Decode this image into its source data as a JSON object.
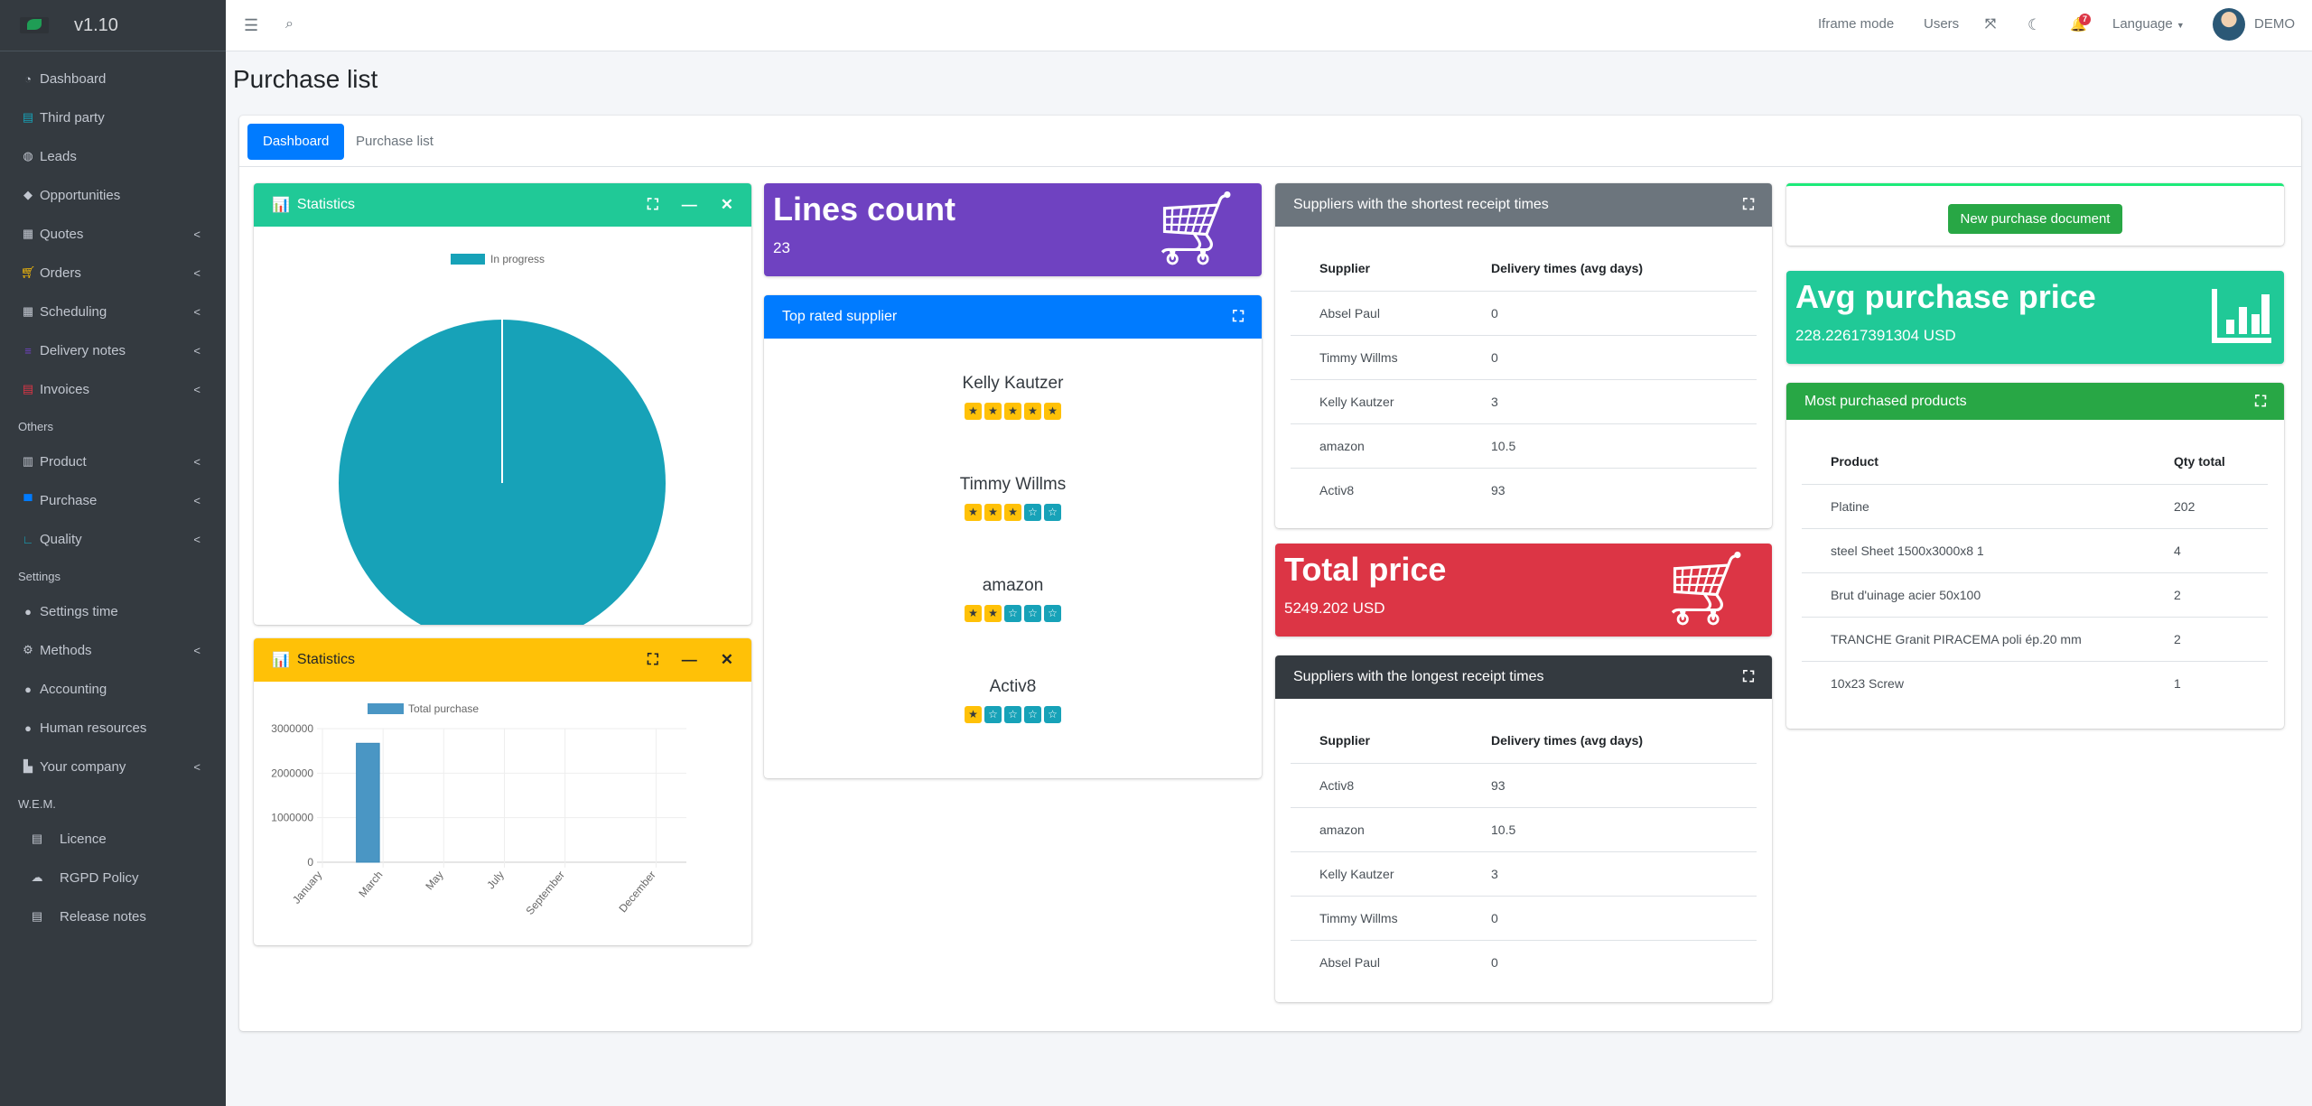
{
  "app": {
    "version": "v1.10"
  },
  "sidebar": {
    "items": [
      {
        "label": "Dashboard",
        "icon": "tachometer-icon"
      },
      {
        "label": "Third party",
        "icon": "address-book-icon"
      },
      {
        "label": "Leads",
        "icon": "globe-icon"
      },
      {
        "label": "Opportunities",
        "icon": "tags-icon"
      },
      {
        "label": "Quotes",
        "icon": "calculator-icon",
        "chevron": true
      },
      {
        "label": "Orders",
        "icon": "cart-icon",
        "chevron": true
      },
      {
        "label": "Scheduling",
        "icon": "calendar-icon",
        "chevron": true
      },
      {
        "label": "Delivery notes",
        "icon": "list-icon",
        "chevron": true
      },
      {
        "label": "Invoices",
        "icon": "invoice-icon",
        "chevron": true
      }
    ],
    "others_header": "Others",
    "others": [
      {
        "label": "Product",
        "icon": "barcode-icon",
        "chevron": true
      },
      {
        "label": "Purchase",
        "icon": "shopping-bag-icon",
        "chevron": true
      },
      {
        "label": "Quality",
        "icon": "ruler-icon",
        "chevron": true
      }
    ],
    "settings_header": "Settings",
    "settings": [
      {
        "label": "Settings time",
        "icon": "user-clock-icon"
      },
      {
        "label": "Methods",
        "icon": "cogs-icon",
        "chevron": true
      },
      {
        "label": "Accounting",
        "icon": "piggy-bank-icon"
      },
      {
        "label": "Human resources",
        "icon": "users-icon"
      },
      {
        "label": "Your company",
        "icon": "industry-icon",
        "chevron": true
      }
    ],
    "wem_header": "W.E.M.",
    "wem": [
      {
        "label": "Licence",
        "icon": "file-icon"
      },
      {
        "label": "RGPD Policy",
        "icon": "cloud-icon"
      },
      {
        "label": "Release notes",
        "icon": "file-icon"
      }
    ]
  },
  "topbar": {
    "iframe_mode": "Iframe mode",
    "users": "Users",
    "notifications": "7",
    "language": "Language",
    "user": "DEMO"
  },
  "page": {
    "title": "Purchase list"
  },
  "tabs": [
    {
      "label": "Dashboard",
      "active": true
    },
    {
      "label": "Purchase list",
      "active": false
    }
  ],
  "statistics_pie": {
    "title": "Statistics",
    "header_color": "#20c997"
  },
  "statistics_bar": {
    "title": "Statistics",
    "header_color": "#ffc107"
  },
  "lines_count": {
    "title": "Lines count",
    "value": "23",
    "color": "#6f42c1"
  },
  "top_rated": {
    "title": "Top rated supplier",
    "suppliers": [
      {
        "name": "Kelly Kautzer",
        "rating": 5
      },
      {
        "name": "Timmy Willms",
        "rating": 3
      },
      {
        "name": "amazon",
        "rating": 2
      },
      {
        "name": "Activ8",
        "rating": 1
      }
    ]
  },
  "shortest": {
    "title": "Suppliers with the shortest receipt times",
    "headers": [
      "Supplier",
      "Delivery times (avg days)"
    ],
    "rows": [
      [
        "Absel Paul",
        "0"
      ],
      [
        "Timmy Willms",
        "0"
      ],
      [
        "Kelly Kautzer",
        "3"
      ],
      [
        "amazon",
        "10.5"
      ],
      [
        "Activ8",
        "93"
      ]
    ]
  },
  "total_price": {
    "title": "Total price",
    "value": "5249.202 USD",
    "color": "#dc3545"
  },
  "longest": {
    "title": "Suppliers with the longest receipt times",
    "headers": [
      "Supplier",
      "Delivery times (avg days)"
    ],
    "rows": [
      [
        "Activ8",
        "93"
      ],
      [
        "amazon",
        "10.5"
      ],
      [
        "Kelly Kautzer",
        "3"
      ],
      [
        "Timmy Willms",
        "0"
      ],
      [
        "Absel Paul",
        "0"
      ]
    ]
  },
  "new_purchase": {
    "label": "New purchase document"
  },
  "avg_price": {
    "title": "Avg purchase price",
    "value": "228.22617391304 USD",
    "color": "#20c997"
  },
  "most_purchased": {
    "title": "Most purchased products",
    "headers": [
      "Product",
      "Qty total"
    ],
    "rows": [
      [
        "Platine",
        "202"
      ],
      [
        "steel Sheet 1500x3000x8 1",
        "4"
      ],
      [
        "Brut d'uinage acier 50x100",
        "2"
      ],
      [
        "TRANCHE Granit PIRACEMA poli ép.20 mm",
        "2"
      ],
      [
        "10x23 Screw",
        "1"
      ]
    ]
  },
  "chart_data": [
    {
      "type": "pie",
      "legend": [
        "In progress"
      ],
      "legend_position": "top",
      "values": [
        100
      ],
      "colors": [
        "#17a2b8"
      ]
    },
    {
      "type": "bar",
      "series": [
        {
          "name": "Total purchase",
          "values": [
            0,
            2670000,
            0,
            0,
            0,
            0,
            0,
            0,
            0,
            0,
            0,
            0
          ]
        }
      ],
      "categories": [
        "January",
        "",
        "March",
        "",
        "May",
        "",
        "July",
        "",
        "September",
        "",
        "",
        "December"
      ],
      "yticks": [
        "0",
        "1000000",
        "2000000",
        "3000000"
      ],
      "ylim": [
        0,
        3000000
      ],
      "grid": true,
      "legend_position": "top",
      "color": "#4a96c4"
    }
  ]
}
